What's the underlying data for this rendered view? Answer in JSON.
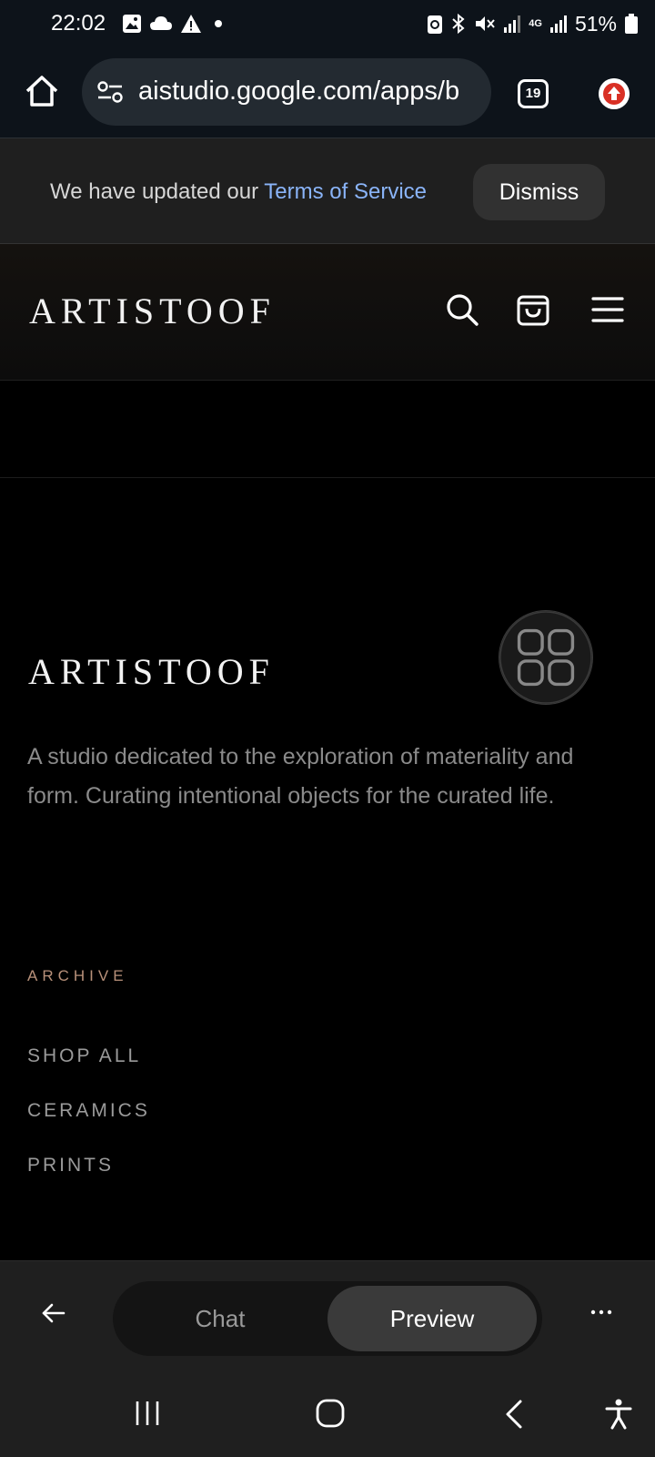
{
  "status_bar": {
    "time": "22:02",
    "left_icons": [
      "image-icon",
      "cloud-icon",
      "warning-icon",
      "dot-icon"
    ],
    "network_label": "4G",
    "battery_percent": "51%"
  },
  "browser": {
    "url": "aistudio.google.com/apps/b",
    "tab_count": "19"
  },
  "banner": {
    "text_prefix": "We have updated our ",
    "link_text": "Terms of Service",
    "dismiss_label": "Dismiss"
  },
  "site_header": {
    "logo": "ARTISTOOF",
    "icons": [
      "search-icon",
      "shopping-bag-icon",
      "menu-icon"
    ]
  },
  "footer": {
    "logo": "ARTISTOOF",
    "description": "A studio dedicated to the exploration of materiality and form. Curating intentional objects for the curated life.",
    "archive_heading": "ARCHIVE",
    "links": [
      "SHOP ALL",
      "CERAMICS",
      "PRINTS"
    ]
  },
  "studio_bar": {
    "chat_label": "Chat",
    "preview_label": "Preview",
    "active_mode": "Preview"
  },
  "colors": {
    "link": "#8ab4f8",
    "archive_accent": "#b8917a",
    "update_icon": "#d93025"
  }
}
